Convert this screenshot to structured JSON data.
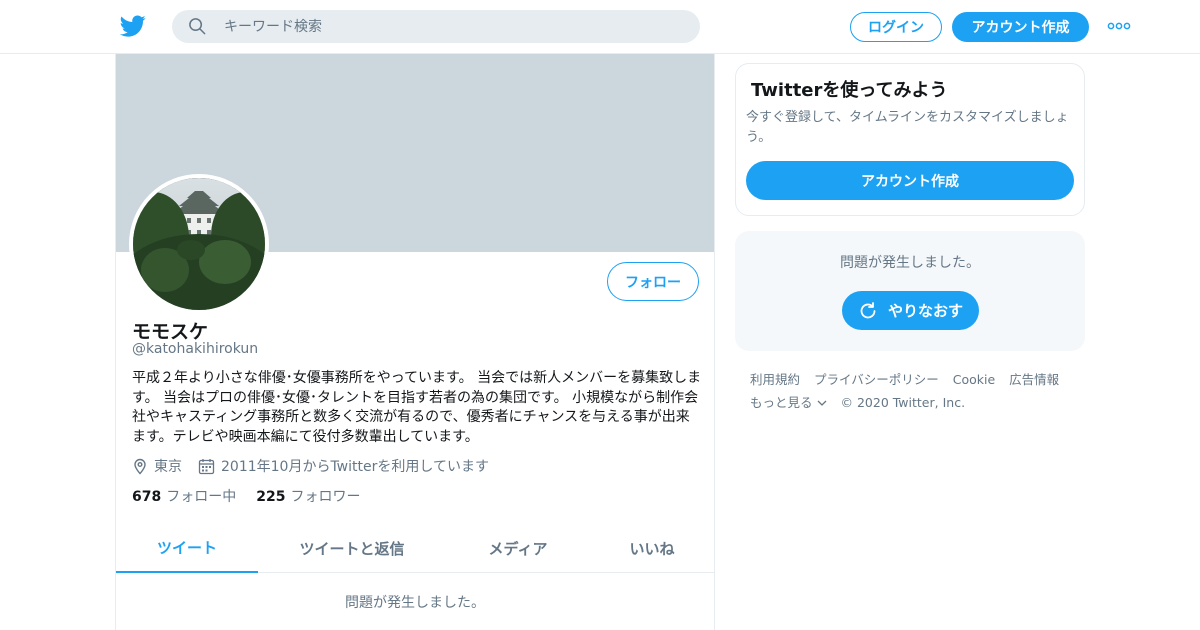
{
  "colors": {
    "accent": "#1da1f2",
    "text": "#14171a",
    "muted": "#657786",
    "banner": "#ccd6dd",
    "border": "#e6ecf0"
  },
  "header": {
    "logo_icon": "twitter-bird-icon",
    "search": {
      "placeholder": "キーワード検索",
      "value": ""
    },
    "login_label": "ログイン",
    "signup_label": "アカウント作成",
    "more_icon": "more-dots-icon"
  },
  "profile": {
    "follow_label": "フォロー",
    "display_name": "モモスケ",
    "handle": "@katohakihirokun",
    "bio": "平成２年より小さな俳優･女優事務所をやっています。 当会では新人メンバーを募集致します。 当会はプロの俳優･女優･タレントを目指す若者の為の集団です。 小規模ながら制作会社やキャスティング事務所と数多く交流が有るので、優秀者にチャンスを与える事が出来ます。テレビや映画本編にて役付多数輩出しています。",
    "location": "東京",
    "joined": "2011年10月からTwitterを利用しています",
    "following_count": "678",
    "following_label": "フォロー中",
    "followers_count": "225",
    "followers_label": "フォロワー"
  },
  "tabs": [
    {
      "label": "ツイート",
      "active": true
    },
    {
      "label": "ツイートと返信",
      "active": false
    },
    {
      "label": "メディア",
      "active": false
    },
    {
      "label": "いいね",
      "active": false
    }
  ],
  "tab_error": "問題が発生しました。",
  "signup_card": {
    "title": "Twitterを使ってみよう",
    "description": "今すぐ登録して、タイムラインをカスタマイズしましょう。",
    "button_label": "アカウント作成"
  },
  "error_card": {
    "message": "問題が発生しました。",
    "retry_label": "やりなおす"
  },
  "footer": {
    "links": [
      "利用規約",
      "プライバシーポリシー",
      "Cookie",
      "広告情報"
    ],
    "more_label": "もっと見る",
    "copyright": "© 2020 Twitter, Inc."
  }
}
